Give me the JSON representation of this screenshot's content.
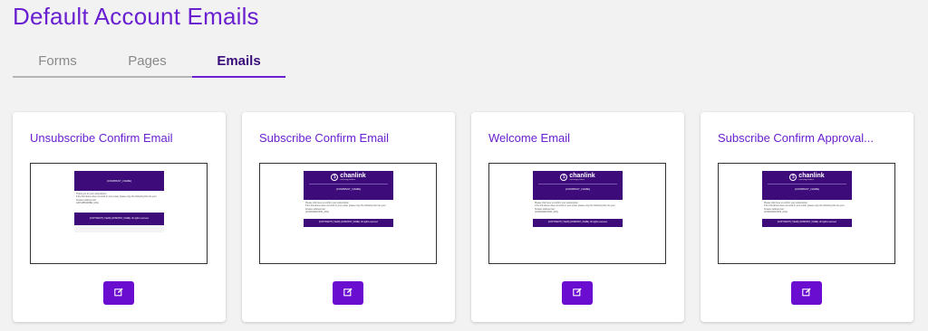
{
  "page": {
    "title": "Default Account Emails"
  },
  "tabs": [
    {
      "label": "Forms"
    },
    {
      "label": "Pages"
    },
    {
      "label": "Emails"
    }
  ],
  "cards": [
    {
      "title": "Unsubscribe Confirm Email",
      "preview": {
        "header_text": "{COMPANY_NAME}",
        "body_lines": [
          "Thank you for your subscription.",
          "If the link above does not work in your email, please copy the following link into your browser address bar:",
          "{UNSUBSCRIBE_URL}"
        ],
        "footer_text": "{COPYRIGHT} {YEAR} {COMPANY_NAME}. All rights reserved."
      }
    },
    {
      "title": "Subscribe Confirm Email",
      "preview": {
        "logo_name": "chanlink",
        "logo_tagline": "marketing platform",
        "header_text": "{COMPANY_NAME}",
        "body_lines": [
          "Please click here to confirm your subscription.",
          "If the link above does not work in your email, please copy the following link into your browser address bar:",
          "{CONFIRMATION_URL}"
        ],
        "footer_text": "{COPYRIGHT} {YEAR} {COMPANY_NAME}. All rights reserved."
      }
    },
    {
      "title": "Welcome Email",
      "preview": {
        "logo_name": "chanlink",
        "logo_tagline": "marketing platform",
        "header_text": "{COMPANY_NAME}",
        "body_lines": [
          "Please click here to confirm your subscription.",
          "If the link above does not work in your email, please copy the following link into your browser address bar:",
          "{CONFIRMATION_URL}"
        ],
        "footer_text": "{COPYRIGHT} {YEAR} {COMPANY_NAME}. All rights reserved."
      }
    },
    {
      "title": "Subscribe Confirm Approval...",
      "preview": {
        "logo_name": "chanlink",
        "logo_tagline": "marketing platform",
        "header_text": "{COMPANY_NAME}",
        "body_lines": [
          "Please click here to confirm your subscription.",
          "If the link above does not work in your email, please copy the following link into your browser address bar:",
          "{CONFIRMATION_URL}"
        ],
        "footer_text": "{COPYRIGHT} {YEAR} {COMPANY_NAME}. All rights reserved."
      }
    }
  ],
  "icons": {
    "edit": "edit-icon"
  },
  "colors": {
    "accent": "#6a1fd0",
    "button": "#6a0dd0",
    "email_brand": "#3d0b7a",
    "background": "#f2f2f2"
  }
}
